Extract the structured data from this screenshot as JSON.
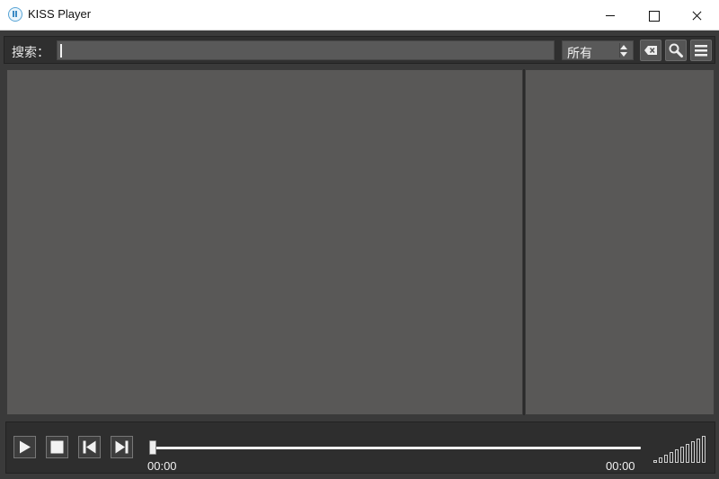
{
  "window": {
    "title": "KISS Player",
    "controls": [
      "minimize",
      "maximize",
      "close"
    ]
  },
  "search": {
    "label": "搜索：",
    "value": "",
    "filter_selected": "所有",
    "buttons": [
      "clear-icon",
      "search-icon",
      "menu-icon"
    ]
  },
  "player": {
    "current_time": "00:00",
    "total_time": "00:00",
    "progress": 0,
    "buttons": [
      "play-icon",
      "stop-icon",
      "previous-icon",
      "next-icon"
    ],
    "volume_level": 1.0
  },
  "colors": {
    "panel": "#595857",
    "chrome": "#2e2e2e",
    "text": "#f0f0f0"
  }
}
